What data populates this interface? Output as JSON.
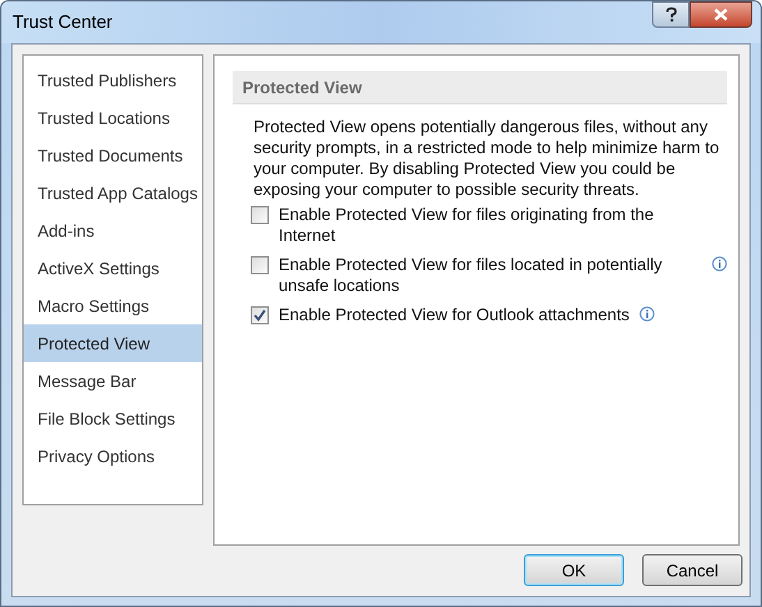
{
  "window": {
    "title": "Trust Center"
  },
  "sidebar": {
    "items": [
      {
        "label": "Trusted Publishers",
        "selected": false
      },
      {
        "label": "Trusted Locations",
        "selected": false
      },
      {
        "label": "Trusted Documents",
        "selected": false
      },
      {
        "label": "Trusted App Catalogs",
        "selected": false
      },
      {
        "label": "Add-ins",
        "selected": false
      },
      {
        "label": "ActiveX Settings",
        "selected": false
      },
      {
        "label": "Macro Settings",
        "selected": false
      },
      {
        "label": "Protected View",
        "selected": true
      },
      {
        "label": "Message Bar",
        "selected": false
      },
      {
        "label": "File Block Settings",
        "selected": false
      },
      {
        "label": "Privacy Options",
        "selected": false
      }
    ]
  },
  "section": {
    "heading": "Protected View",
    "description": "Protected View opens potentially dangerous files, without any security prompts, in a restricted mode to help minimize harm to your computer. By disabling Protected View you could be exposing your computer to possible security threats.",
    "options": [
      {
        "label": "Enable Protected View for files originating from the Internet",
        "checked": false,
        "info": false
      },
      {
        "label": "Enable Protected View for files located in potentially unsafe locations",
        "checked": false,
        "info": true
      },
      {
        "label": "Enable Protected View for Outlook attachments",
        "checked": true,
        "info": true
      }
    ]
  },
  "buttons": [
    {
      "label": "OK",
      "default": true
    },
    {
      "label": "Cancel",
      "default": false
    }
  ]
}
